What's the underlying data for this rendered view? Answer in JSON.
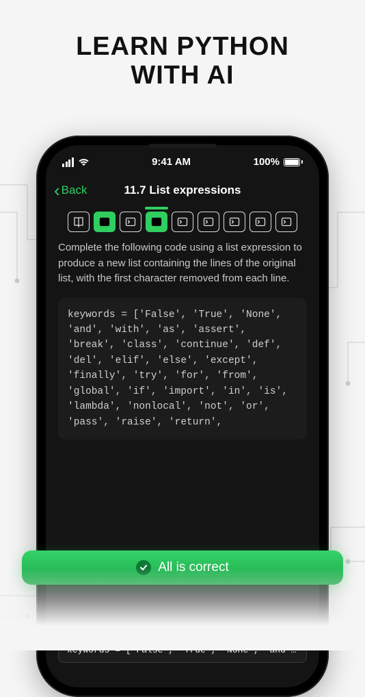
{
  "headline": {
    "line1": "LEARN PYTHON",
    "line2": "WITH AI"
  },
  "status": {
    "time": "9:41 AM",
    "battery_pct": "100%"
  },
  "nav": {
    "back_label": "Back",
    "title": "11.7 List expressions"
  },
  "steps": [
    {
      "kind": "book",
      "active": false,
      "current": false
    },
    {
      "kind": "term",
      "active": true,
      "current": false
    },
    {
      "kind": "term",
      "active": false,
      "current": false
    },
    {
      "kind": "term",
      "active": true,
      "current": true
    },
    {
      "kind": "term",
      "active": false,
      "current": false
    },
    {
      "kind": "term",
      "active": false,
      "current": false
    },
    {
      "kind": "term",
      "active": false,
      "current": false
    },
    {
      "kind": "term",
      "active": false,
      "current": false
    },
    {
      "kind": "term",
      "active": false,
      "current": false
    }
  ],
  "instruction": "Complete the following code using a list expression to produce a new list containing the lines of the original list, with the first character removed from each line.",
  "code": "keywords = ['False', 'True', 'None', 'and', 'with', 'as', 'assert', 'break', 'class', 'continue', 'def', 'del', 'elif', 'else', 'except', 'finally', 'try', 'for', 'from', 'global', 'if', 'import', 'in', 'is', 'lambda', 'nonlocal', 'not', 'or', 'pass', 'raise', 'return',",
  "toast": {
    "label": "All is correct"
  },
  "answer_chip": "keywords = ['False', 'True', 'None', 'and', 'w…",
  "colors": {
    "accent": "#2fcf5f",
    "toast_start": "#34d268",
    "toast_end": "#1fa84a"
  }
}
